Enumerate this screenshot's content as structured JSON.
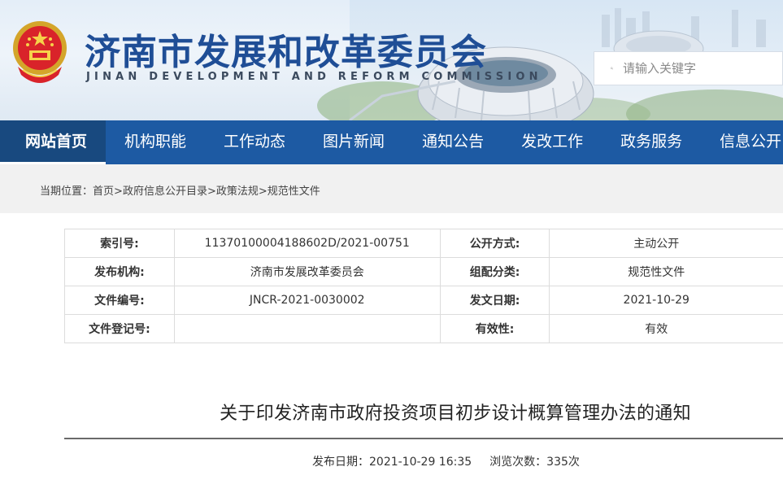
{
  "header": {
    "title": "济南市发展和改革委员会",
    "subtitle": "JINAN DEVELOPMENT AND REFORM COMMISSION",
    "search_placeholder": "请输入关键字",
    "colors": {
      "brand_blue": "#1f4e96",
      "nav_blue": "#1d5aa3",
      "nav_active": "#18497f"
    }
  },
  "nav": {
    "items": [
      {
        "label": "网站首页",
        "active": true
      },
      {
        "label": "机构职能"
      },
      {
        "label": "工作动态"
      },
      {
        "label": "图片新闻"
      },
      {
        "label": "通知公告"
      },
      {
        "label": "发改工作"
      },
      {
        "label": "政务服务"
      },
      {
        "label": "信息公开"
      }
    ]
  },
  "breadcrumb": {
    "prefix": "当期位置：",
    "items": [
      "首页",
      "政府信息公开目录",
      "政策法规",
      "规范性文件"
    ],
    "separator": ">"
  },
  "info": {
    "rows": [
      {
        "k1": "索引号:",
        "v1": "11370100004188602D/2021-00751",
        "k2": "公开方式:",
        "v2": "主动公开"
      },
      {
        "k1": "发布机构:",
        "v1": "济南市发展改革委员会",
        "k2": "组配分类:",
        "v2": "规范性文件"
      },
      {
        "k1": "文件编号:",
        "v1": "JNCR-2021-0030002",
        "k2": "发文日期:",
        "v2": "2021-10-29"
      },
      {
        "k1": "文件登记号:",
        "v1": "",
        "k2": "有效性:",
        "v2": "有效"
      }
    ]
  },
  "article": {
    "title": "关于印发济南市政府投资项目初步设计概算管理办法的通知",
    "publish_label": "发布日期：",
    "publish_date": "2021-10-29 16:35",
    "views_label": "浏览次数：",
    "views": "335次"
  },
  "icons": {
    "search": "search-icon",
    "emblem": "national-emblem-icon"
  }
}
